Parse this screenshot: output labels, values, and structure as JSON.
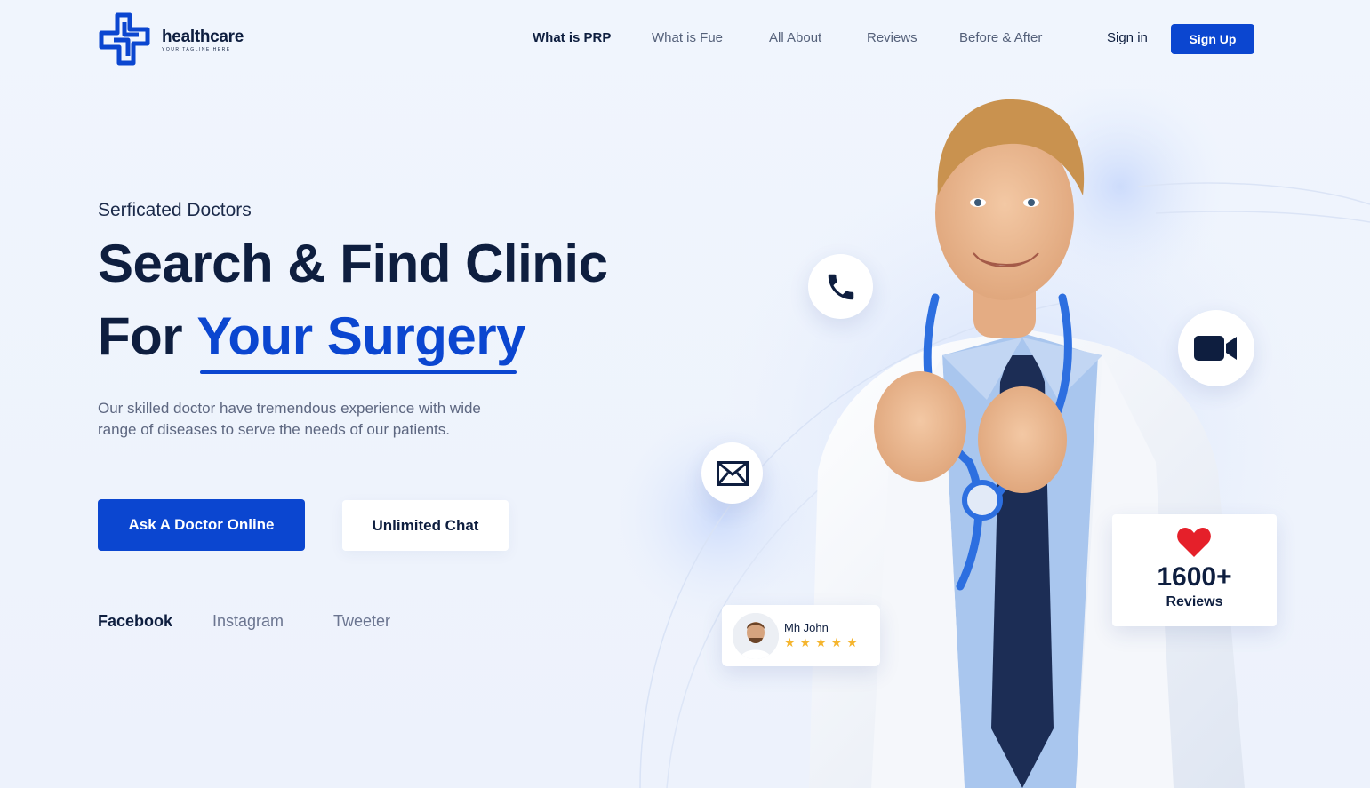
{
  "brand": {
    "name": "healthcare",
    "tagline": "YOUR TAGLINE HERE",
    "accent_color": "#0b46d0",
    "dark_color": "#0e1e3f"
  },
  "nav": {
    "items": [
      {
        "label": "What is PRP",
        "active": true
      },
      {
        "label": "What is Fue",
        "active": false
      },
      {
        "label": "All About",
        "active": false
      },
      {
        "label": "Reviews",
        "active": false
      },
      {
        "label": "Before & After",
        "active": false
      }
    ],
    "sign_in": "Sign in",
    "sign_up": "Sign Up"
  },
  "hero": {
    "eyebrow": "Serficated Doctors",
    "headline_line1": "Search & Find Clinic",
    "headline_line2_prefix": "For",
    "headline_line2_accent": "Your Surgery",
    "description": "Our skilled doctor have tremendous experience with wide range of diseases to serve the needs of our patients.",
    "primary_cta": "Ask A Doctor Online",
    "secondary_cta": "Unlimited Chat"
  },
  "social": [
    "Facebook",
    "Instagram",
    "Tweeter"
  ],
  "contact_icons": [
    "phone-icon",
    "video-camera-icon",
    "mail-icon"
  ],
  "review_card": {
    "name": "Mh John",
    "rating": 5,
    "stars": "★★★★★"
  },
  "stat_card": {
    "icon": "heart-icon",
    "number": "1600+",
    "label": "Reviews"
  }
}
